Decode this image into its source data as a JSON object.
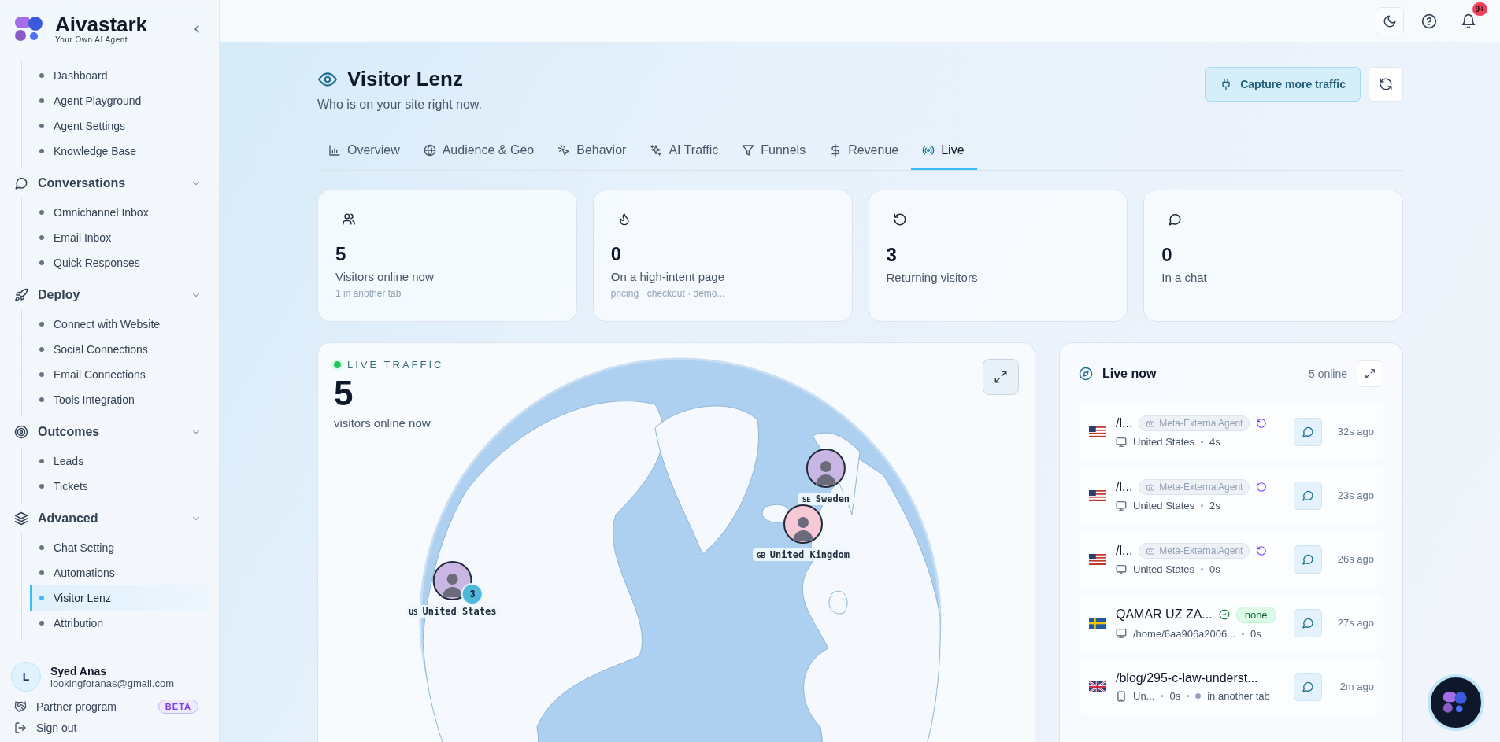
{
  "brand": {
    "name": "Aivastark",
    "tagline": "Your Own AI Agent"
  },
  "sidebar": {
    "groups": [
      {
        "items": [
          {
            "label": "Dashboard",
            "selected": false
          },
          {
            "label": "Agent Playground",
            "selected": false
          },
          {
            "label": "Agent Settings",
            "selected": false
          },
          {
            "label": "Knowledge Base",
            "selected": false
          }
        ]
      },
      {
        "title": "Conversations",
        "expanded": true,
        "items": [
          {
            "label": "Omnichannel Inbox",
            "selected": false
          },
          {
            "label": "Email Inbox",
            "selected": false
          },
          {
            "label": "Quick Responses",
            "selected": false
          }
        ]
      },
      {
        "title": "Deploy",
        "expanded": true,
        "items": [
          {
            "label": "Connect with Website",
            "selected": false
          },
          {
            "label": "Social Connections",
            "selected": false
          },
          {
            "label": "Email Connections",
            "selected": false
          },
          {
            "label": "Tools Integration",
            "selected": false
          }
        ]
      },
      {
        "title": "Outcomes",
        "expanded": true,
        "items": [
          {
            "label": "Leads",
            "selected": false
          },
          {
            "label": "Tickets",
            "selected": false
          }
        ]
      },
      {
        "title": "Advanced",
        "expanded": true,
        "items": [
          {
            "label": "Chat Setting",
            "selected": false
          },
          {
            "label": "Automations",
            "selected": false
          },
          {
            "label": "Visitor Lenz",
            "selected": true
          },
          {
            "label": "Attribution",
            "selected": false
          }
        ]
      }
    ],
    "user": {
      "initial": "L",
      "name": "Syed Anas",
      "email": "lookingforanas@gmail.com"
    },
    "partner": {
      "label": "Partner program",
      "badge": "BETA"
    },
    "sign_out": "Sign out"
  },
  "topbar": {
    "notification_badge": "9+"
  },
  "page": {
    "title": "Visitor Lenz",
    "subtitle": "Who is on your site right now.",
    "primary_action": "Capture more traffic"
  },
  "tabs": [
    {
      "label": "Overview",
      "selected": false
    },
    {
      "label": "Audience & Geo",
      "selected": false
    },
    {
      "label": "Behavior",
      "selected": false
    },
    {
      "label": "AI Traffic",
      "selected": false
    },
    {
      "label": "Funnels",
      "selected": false
    },
    {
      "label": "Revenue",
      "selected": false
    },
    {
      "label": "Live",
      "selected": true
    }
  ],
  "stats": [
    {
      "value": "5",
      "label": "Visitors online now",
      "note": "1 in another tab"
    },
    {
      "value": "0",
      "label": "On a high-intent page",
      "note": "pricing · checkout · demo..."
    },
    {
      "value": "3",
      "label": "Returning visitors"
    },
    {
      "value": "0",
      "label": "In a chat"
    }
  ],
  "live_traffic": {
    "label": "LIVE TRAFFIC",
    "count": "5",
    "caption": "visitors online now",
    "markers": [
      {
        "code": "US",
        "country": "United States",
        "count": "3"
      },
      {
        "code": "SE",
        "country": "Sweden"
      },
      {
        "code": "GB",
        "country": "United Kingdom"
      }
    ]
  },
  "live_now": {
    "title": "Live now",
    "online": "5 online",
    "visitors": [
      {
        "flag": {
          "kind": "us"
        },
        "title": "/l...",
        "agent": "Meta-ExternalAgent",
        "returning": true,
        "verified": false,
        "device": {
          "kind": "desktop"
        },
        "detail": "United States",
        "duration": "4s",
        "time": "32s ago"
      },
      {
        "flag": {
          "kind": "us"
        },
        "title": "/l...",
        "agent": "Meta-ExternalAgent",
        "returning": true,
        "verified": false,
        "device": {
          "kind": "desktop"
        },
        "detail": "United States",
        "duration": "2s",
        "time": "23s ago"
      },
      {
        "flag": {
          "kind": "us"
        },
        "title": "/l...",
        "agent": "Meta-ExternalAgent",
        "returning": true,
        "verified": false,
        "device": {
          "kind": "desktop"
        },
        "detail": "United States",
        "duration": "0s",
        "time": "26s ago"
      },
      {
        "flag": {
          "kind": "se"
        },
        "title": "QAMAR UZ ZA...",
        "returning": false,
        "verified": true,
        "tag": "none",
        "device": {
          "kind": "desktop"
        },
        "detail": "/home/6aa906a2006...",
        "duration": "0s",
        "time": "27s ago"
      },
      {
        "flag": {
          "kind": "gb"
        },
        "title": "/blog/295-c-law-underst...",
        "returning": false,
        "verified": false,
        "device": {
          "kind": "mobile"
        },
        "detail": "Un...",
        "duration": "0s",
        "note": "in another tab",
        "time": "2m ago"
      }
    ]
  }
}
